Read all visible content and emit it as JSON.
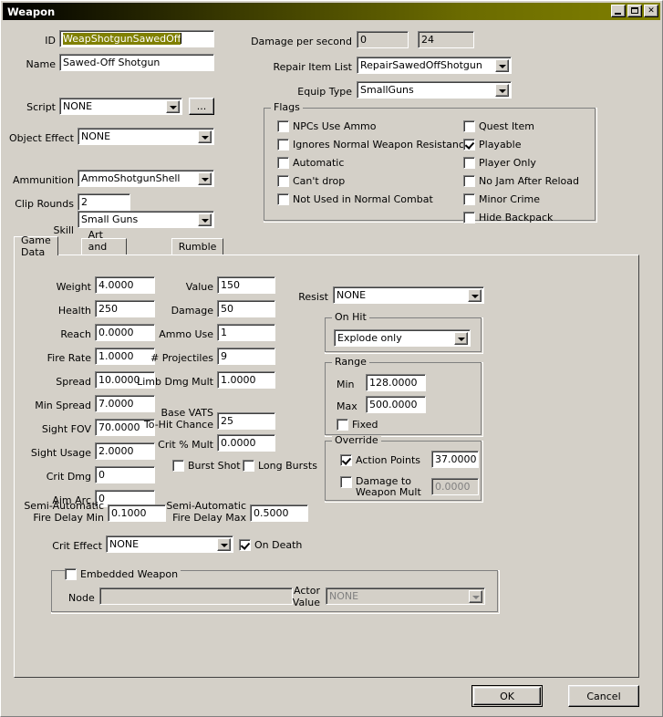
{
  "window": {
    "title": "Weapon",
    "buttons": {
      "minimize": "minimize-icon",
      "maximize": "maximize-icon",
      "close": "✕"
    }
  },
  "top": {
    "id_label": "ID",
    "id_value": "WeapShotgunSawedOff",
    "name_label": "Name",
    "name_value": "Sawed-Off Shotgun",
    "script_label": "Script",
    "script_value": "NONE",
    "script_browse": "...",
    "object_effect_label": "Object Effect",
    "object_effect_value": "NONE",
    "ammunition_label": "Ammunition",
    "ammunition_value": "AmmoShotgunShell",
    "clip_rounds_label": "Clip Rounds",
    "clip_rounds_value": "2",
    "skill_label": "Skill",
    "skill_value": "Small Guns",
    "dps_label": "Damage per second",
    "dps_value_1": "0",
    "dps_value_2": "24",
    "repair_label": "Repair Item List",
    "repair_value": "RepairSawedOffShotgun",
    "equip_label": "Equip Type",
    "equip_value": "SmallGuns"
  },
  "flags": {
    "title": "Flags",
    "left": [
      {
        "label": "NPCs Use Ammo",
        "checked": false
      },
      {
        "label": "Ignores Normal Weapon Resistance",
        "checked": false
      },
      {
        "label": "Automatic",
        "checked": false
      },
      {
        "label": "Can't drop",
        "checked": false
      },
      {
        "label": "Not Used in Normal Combat",
        "checked": false
      }
    ],
    "right": [
      {
        "label": "Quest Item",
        "checked": false
      },
      {
        "label": "Playable",
        "checked": true
      },
      {
        "label": "Player Only",
        "checked": false
      },
      {
        "label": "No Jam After Reload",
        "checked": false
      },
      {
        "label": "Minor Crime",
        "checked": false
      },
      {
        "label": "Hide Backpack",
        "checked": false
      }
    ]
  },
  "tabs": [
    {
      "label": "Game Data",
      "active": true
    },
    {
      "label": "Art and Sound",
      "active": false
    },
    {
      "label": "Rumble",
      "active": false
    }
  ],
  "gamedata": {
    "col1": [
      {
        "label": "Weight",
        "value": "4.0000"
      },
      {
        "label": "Health",
        "value": "250"
      },
      {
        "label": "Reach",
        "value": "0.0000"
      },
      {
        "label": "Fire Rate",
        "value": "1.0000"
      },
      {
        "label": "Spread",
        "value": "10.0000"
      },
      {
        "label": "Min Spread",
        "value": "7.0000"
      },
      {
        "label": "Sight FOV",
        "value": "70.0000"
      },
      {
        "label": "Sight Usage",
        "value": "2.0000"
      },
      {
        "label": "Crit Dmg",
        "value": "0"
      },
      {
        "label": "Aim Arc",
        "value": "0"
      }
    ],
    "col2": [
      {
        "label": "Value",
        "value": "150"
      },
      {
        "label": "Damage",
        "value": "50"
      },
      {
        "label": "Ammo Use",
        "value": "1"
      },
      {
        "label": "# Projectiles",
        "value": "9"
      },
      {
        "label": "Limb Dmg Mult",
        "value": "1.0000"
      }
    ],
    "base_vats_label_1": "Base VATS",
    "base_vats_label_2": "To-Hit Chance",
    "base_vats_value": "25",
    "crit_mult_label": "Crit % Mult",
    "crit_mult_value": "0.0000",
    "burst_shot_label": "Burst Shot",
    "burst_shot_checked": false,
    "long_bursts_label": "Long Bursts",
    "long_bursts_checked": false,
    "semi_min_label_1": "Semi-Automatic",
    "semi_min_label_2": "Fire Delay Min",
    "semi_min_value": "0.1000",
    "semi_max_label_1": "Semi-Automatic",
    "semi_max_label_2": "Fire Delay Max",
    "semi_max_value": "0.5000",
    "crit_effect_label": "Crit Effect",
    "crit_effect_value": "NONE",
    "on_death_label": "On Death",
    "on_death_checked": true,
    "resist_label": "Resist",
    "resist_value": "NONE",
    "on_hit": {
      "title": "On Hit",
      "value": "Explode only"
    },
    "range": {
      "title": "Range",
      "min_label": "Min",
      "min_value": "128.0000",
      "max_label": "Max",
      "max_value": "500.0000",
      "fixed_label": "Fixed",
      "fixed_checked": false
    },
    "override": {
      "title": "Override",
      "action_points_label": "Action Points",
      "action_points_checked": true,
      "action_points_value": "37.0000",
      "dmg_weapon_label_1": "Damage to",
      "dmg_weapon_label_2": "Weapon Mult",
      "dmg_weapon_checked": false,
      "dmg_weapon_value": "0.0000"
    },
    "embedded": {
      "title": "Embedded Weapon",
      "checked": false,
      "node_label": "Node",
      "node_value": "",
      "actor_value_label_1": "Actor",
      "actor_value_label_2": "Value",
      "actor_value": "NONE"
    }
  },
  "footer": {
    "ok_label": "OK",
    "cancel_label": "Cancel"
  },
  "colors": {
    "titlebar_accent": "#808000",
    "selection": "#808000",
    "face": "#d4d0c8"
  }
}
